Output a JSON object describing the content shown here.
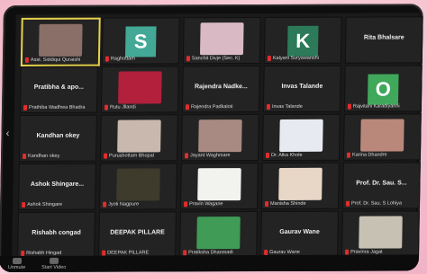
{
  "tiles": [
    {
      "row": 0,
      "col": 0,
      "name": "Asst. Siddiqui Quraishi",
      "type": "photo",
      "photo": "#8a6f68",
      "active": true
    },
    {
      "row": 0,
      "col": 1,
      "name": "Raghottam",
      "type": "letter",
      "letter": "S",
      "letter_bg": "#43a896"
    },
    {
      "row": 0,
      "col": 2,
      "name": "Sanchit Divje (Sec. K)",
      "type": "photo",
      "photo": "#d8b9c4"
    },
    {
      "row": 0,
      "col": 3,
      "name": "Kalyani Suryawanshi",
      "type": "letter",
      "letter": "K",
      "letter_bg": "#2c7a5a"
    },
    {
      "row": 0,
      "col": 4,
      "name": "",
      "center": "Rita Bhalsare",
      "type": "text"
    },
    {
      "row": 1,
      "col": 0,
      "name": "Prathiba Wadhwa Bhadra",
      "center": "Pratibha & apo...",
      "type": "text"
    },
    {
      "row": 1,
      "col": 1,
      "name": "Rutu Jllandi",
      "type": "photo",
      "photo": "#b2203c"
    },
    {
      "row": 1,
      "col": 2,
      "name": "Rajendra Padkaloti",
      "center": "Rajendra Nadke...",
      "type": "text"
    },
    {
      "row": 1,
      "col": 3,
      "name": "Invas Talande",
      "center": "Invas Talande",
      "type": "text"
    },
    {
      "row": 1,
      "col": 4,
      "name": "Rajvitani Karadiyanni",
      "type": "letter",
      "letter": "O",
      "letter_bg": "#3fa85b"
    },
    {
      "row": 2,
      "col": 0,
      "name": "Kandhan okey",
      "center": "Kandhan okey",
      "type": "text"
    },
    {
      "row": 2,
      "col": 1,
      "name": "Purushottam Bhopal",
      "type": "photo",
      "photo": "#c9b8ae"
    },
    {
      "row": 2,
      "col": 2,
      "name": "Jayant Waghmare",
      "type": "photo",
      "photo": "#a88a82"
    },
    {
      "row": 2,
      "col": 3,
      "name": "Dr. Alka Khole",
      "type": "photo",
      "photo": "#e7eaf0"
    },
    {
      "row": 2,
      "col": 4,
      "name": "Karina Dhandre",
      "type": "photo",
      "photo": "#b9887b"
    },
    {
      "row": 3,
      "col": 0,
      "name": "Ashok Shingare",
      "center": "Ashok Shingare...",
      "type": "text"
    },
    {
      "row": 3,
      "col": 1,
      "name": "Jyoti Nagpure",
      "type": "photo",
      "photo": "#3e3a2c"
    },
    {
      "row": 3,
      "col": 2,
      "name": "Pravin Wagane",
      "type": "photo",
      "photo": "#f2f2ee"
    },
    {
      "row": 3,
      "col": 3,
      "name": "Manisha Shinde",
      "type": "photo",
      "photo": "#e8d6c6"
    },
    {
      "row": 3,
      "col": 4,
      "name": "Prof. Dr. Sau. S Lohiya",
      "center": "Prof. Dr. Sau. S...",
      "type": "text"
    },
    {
      "row": 4,
      "col": 0,
      "name": "Rishabh Hingad",
      "center": "Rishabh congad",
      "type": "text"
    },
    {
      "row": 4,
      "col": 1,
      "name": "DEEPAK PILLARE",
      "center": "DEEPAK PILLARE",
      "type": "text"
    },
    {
      "row": 4,
      "col": 2,
      "name": "Pratiksha Dhanmadi",
      "type": "photo",
      "photo": "#3f9b55"
    },
    {
      "row": 4,
      "col": 3,
      "name": "Gaurav Wane",
      "center": "Gaurav Wane",
      "type": "text"
    },
    {
      "row": 4,
      "col": 4,
      "name": "Pravinra Jagat",
      "type": "photo",
      "photo": "#c7c1b4"
    }
  ],
  "toolbar": {
    "unmute": "Unmute",
    "start_video": "Start Video"
  }
}
